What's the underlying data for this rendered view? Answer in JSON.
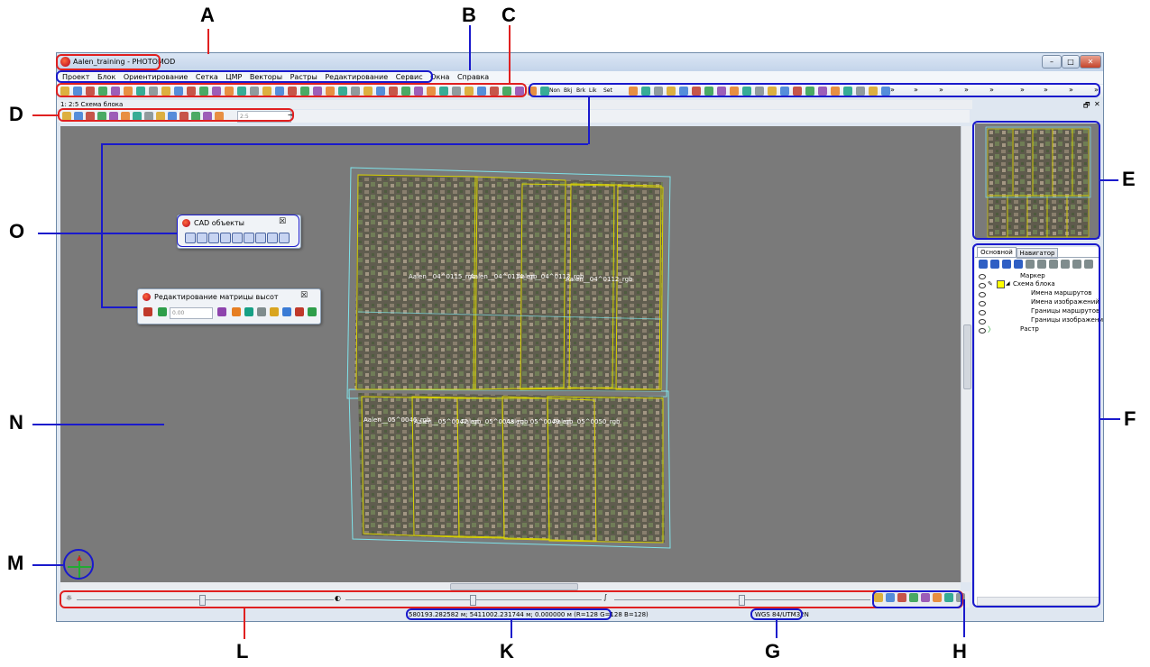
{
  "window": {
    "title": "Aalen_training - PHOTOMOD",
    "controls": [
      "–",
      "□",
      "✕"
    ]
  },
  "menu": [
    "Проект",
    "Блок",
    "Ориентирование",
    "Сетка",
    "ЦМР",
    "Векторы",
    "Растры",
    "Редактирование",
    "Сервис",
    "Окна",
    "Справка"
  ],
  "toolbar_texts": [
    "Non",
    "Bkj",
    "Brk",
    "Lik",
    "Set",
    "»",
    "»",
    "»",
    "»",
    "»",
    "»",
    "»",
    "»",
    "»"
  ],
  "doc": {
    "title": "1: 2:5 Схема блока",
    "scale": "2:5"
  },
  "cad_window": {
    "title": "CAD объекты",
    "close": "☒"
  },
  "dem_window": {
    "title": "Редактирование матрицы высот",
    "value": "0.00",
    "close": "☒"
  },
  "image_labels": {
    "row1": [
      "Aalen__04^0115_rgb",
      "Aalen__04^0114_rgb",
      "Aalen__04^0113_rgb",
      "Aalen__04^0112_rgb"
    ],
    "row2": [
      "Aalen__05^0046_rgb",
      "Aalen__05^0047_rgb",
      "Aalen__05^0048_rgb",
      "Aalen__05^0049_rgb",
      "Aalen__05^0050_rgb"
    ]
  },
  "panel": {
    "tabs": [
      "Основной",
      "Навигатор"
    ],
    "layers": [
      "Маркер",
      "Схема блока",
      "Имена маршрутов",
      "Имена изображений",
      "Границы маршрутов",
      "Границы изображени",
      "Растр"
    ]
  },
  "status": {
    "coords": "580193.282582 м; 5411002.231744 м; 0.000000 м   (R=128 G=128 B=128)",
    "crs": "WGS 84/UTM32N"
  },
  "callouts": [
    "A",
    "B",
    "C",
    "D",
    "E",
    "F",
    "G",
    "H",
    "K",
    "L",
    "M",
    "N",
    "O"
  ],
  "colors": {
    "red_frame": "#e02020",
    "blue_frame": "#1a1acc",
    "tile_border": "#d9d200",
    "block_border": "#7fe3ea"
  }
}
